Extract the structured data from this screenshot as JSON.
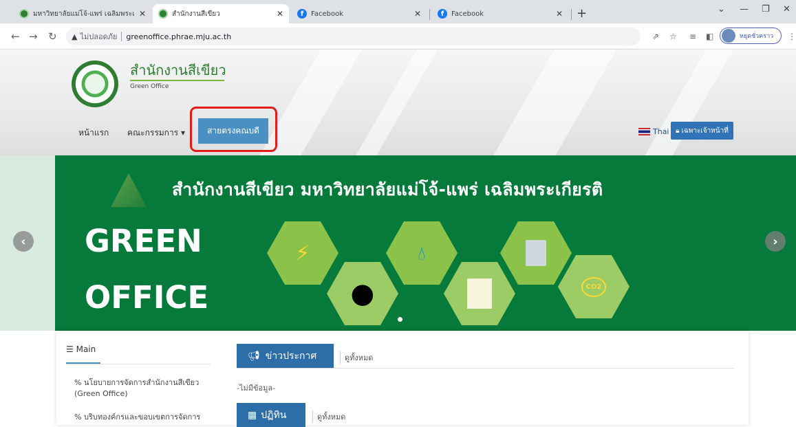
{
  "browser": {
    "tabs": [
      {
        "title": "มหาวิทยาลัยแม่โจ้-แพร่ เฉลิมพระเกียรติ",
        "icon": "green-globe-icon",
        "active": false
      },
      {
        "title": "สำนักงานสีเขียว",
        "icon": "green-globe-icon",
        "active": true
      },
      {
        "title": "Facebook",
        "icon": "facebook-icon",
        "active": false
      },
      {
        "title": "Facebook",
        "icon": "facebook-icon",
        "active": false
      }
    ],
    "insecure_label": "ไม่ปลอดภัย",
    "url": "greenoffice.phrae.mju.ac.th",
    "profile_label": "หยุดชั่วคราว"
  },
  "site": {
    "title": "สำนักงานสีเขียว",
    "subtitle": "Green Office",
    "menu": {
      "home": "หน้าแรก",
      "committee": "คณะกรรมการ",
      "hotline": "สายตรงคณบดี"
    },
    "language": "Thai",
    "staff_only": "เฉพาะเจ้าหน้าที่"
  },
  "banner": {
    "title": "สำนักงานสีเขียว มหาวิทยาลัยแม่โจ้-แพร่ เฉลิมพระเกียรติ",
    "line1": "GREEN",
    "line2": "OFFICE",
    "co2": "CO2"
  },
  "sidebar": {
    "heading": "Main",
    "links": [
      "นโยบายการจัดการสำนักงานสีเขียว (Green Office)",
      "บริบทองค์กรและขอบเขตการจัดการ"
    ]
  },
  "sections": {
    "news": "ข่าวประกาศ",
    "news_see_all": "ดูทั้งหมด",
    "no_data": "-ไม่มีข้อมูล-",
    "calendar": "ปฏิทิน",
    "calendar_see_all": "ดูทั้งหมด"
  },
  "colors": {
    "brand_green": "#067a3a",
    "menu_blue": "#4a90c2",
    "highlight_red": "#e31b1b"
  }
}
